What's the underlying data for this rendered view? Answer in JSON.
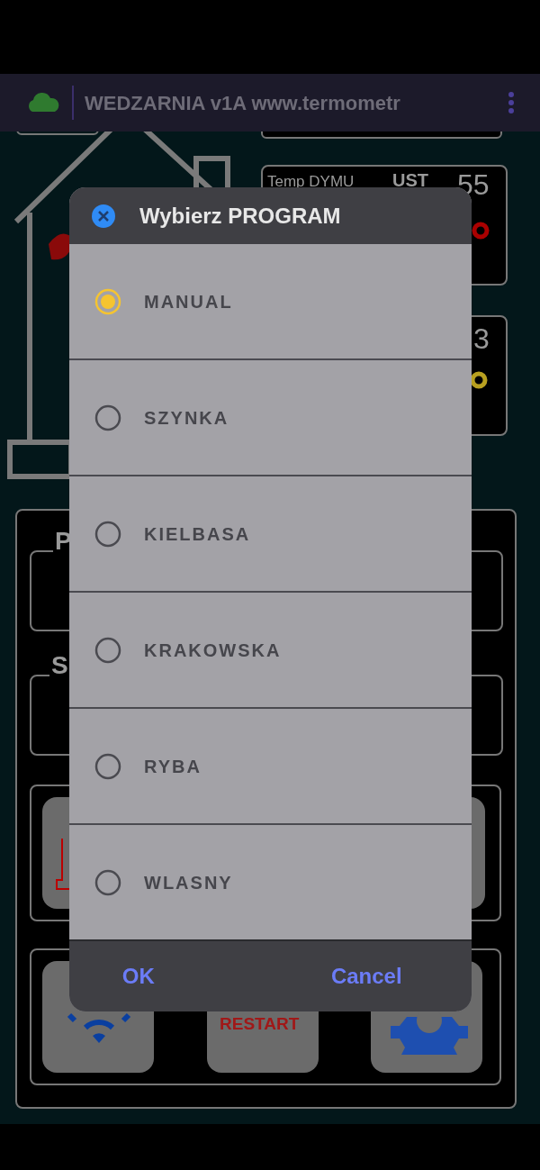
{
  "app_bar": {
    "title": "WEDZARNIA v1A www.termometr"
  },
  "background": {
    "smoke_panel": {
      "label": "Temp DYMU",
      "set_label": "UST",
      "set_value": "55"
    },
    "second_panel": {
      "value": "3"
    },
    "sections": [
      "P",
      "S"
    ],
    "restart_button": "RESTART"
  },
  "dialog": {
    "title": "Wybierz PROGRAM",
    "options": [
      {
        "label": "MANUAL",
        "selected": true
      },
      {
        "label": "SZYNKA",
        "selected": false
      },
      {
        "label": "KIELBASA",
        "selected": false
      },
      {
        "label": "KRAKOWSKA",
        "selected": false
      },
      {
        "label": "RYBA",
        "selected": false
      },
      {
        "label": "WLASNY",
        "selected": false
      }
    ],
    "buttons": [
      "OK",
      "Cancel"
    ]
  }
}
